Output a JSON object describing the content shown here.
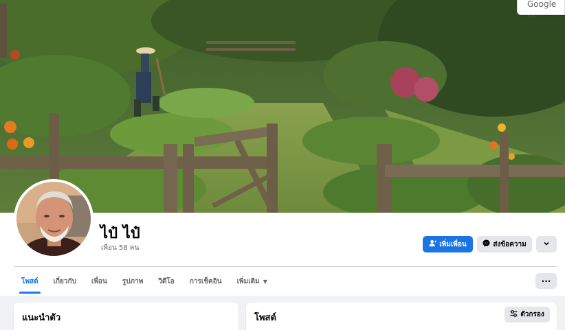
{
  "language_widget": {
    "label": "Google ..."
  },
  "profile": {
    "name": "ไป๋ ไป๋",
    "friend_count": "เพื่อน 58 คน"
  },
  "actions": {
    "add_friend": "เพิ่มเพื่อน",
    "message": "ส่งข้อความ",
    "more_chevron": "⌄"
  },
  "tabs": [
    {
      "label": "โพสต์",
      "active": true
    },
    {
      "label": "เกี่ยวกับ"
    },
    {
      "label": "เพื่อน"
    },
    {
      "label": "รูปภาพ"
    },
    {
      "label": "วิดีโอ"
    },
    {
      "label": "การเช็คอิน"
    },
    {
      "label": "เพิ่มเติม"
    }
  ],
  "tabs_more": "···",
  "panels": {
    "intro_title": "แนะนำตัว",
    "posts_title": "โพสต์",
    "filter_label": "ตัวกรอง"
  },
  "colors": {
    "primary": "#1b74e4",
    "tab_active": "#1877f2",
    "secondary_button": "#e4e6eb",
    "page_bg": "#f0f2f5"
  },
  "icons": {
    "add_friend": "person-plus-icon",
    "message": "messenger-icon",
    "more": "chevron-down-icon",
    "filter": "sliders-icon",
    "tab_more": "caret-down-icon"
  }
}
